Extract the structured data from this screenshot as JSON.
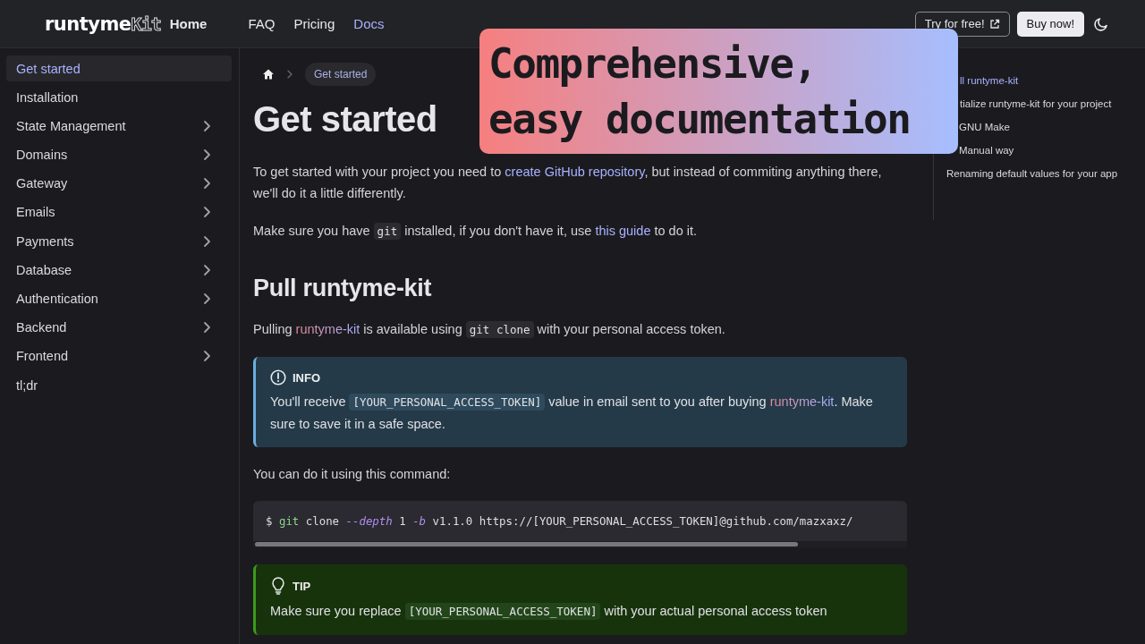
{
  "header": {
    "logo": {
      "word": "runtyme",
      "mark": "Kit"
    },
    "nav": [
      {
        "label": "Home",
        "selected": false
      },
      {
        "label": "FAQ",
        "selected": false
      },
      {
        "label": "Pricing",
        "selected": false
      },
      {
        "label": "Docs",
        "selected": true
      }
    ],
    "try_button": "Try for free!",
    "buy_button": "Buy now!"
  },
  "banner": {
    "lines": [
      "Comprehensive,",
      "easy documentation"
    ]
  },
  "sidebar": {
    "items": [
      {
        "label": "Get started",
        "selected": true,
        "expandable": false
      },
      {
        "label": "Installation",
        "selected": false,
        "expandable": false
      },
      {
        "label": "State Management",
        "selected": false,
        "expandable": true
      },
      {
        "label": "Domains",
        "selected": false,
        "expandable": true
      },
      {
        "label": "Gateway",
        "selected": false,
        "expandable": true
      },
      {
        "label": "Emails",
        "selected": false,
        "expandable": true
      },
      {
        "label": "Payments",
        "selected": false,
        "expandable": true
      },
      {
        "label": "Database",
        "selected": false,
        "expandable": true
      },
      {
        "label": "Authentication",
        "selected": false,
        "expandable": true
      },
      {
        "label": "Backend",
        "selected": false,
        "expandable": true
      },
      {
        "label": "Frontend",
        "selected": false,
        "expandable": true
      },
      {
        "label": "tl;dr",
        "selected": false,
        "expandable": false
      }
    ]
  },
  "breadcrumb": {
    "current": "Get started"
  },
  "content": [
    {
      "kind": "title",
      "text": "Get started"
    },
    {
      "kind": "paragraph",
      "segments": [
        {
          "kind": "text",
          "text": "To get started with your project you need to "
        },
        {
          "kind": "link",
          "text": "create GitHub repository"
        },
        {
          "kind": "text",
          "text": ", but instead of commiting anything there, we'll do it a little differently."
        }
      ]
    },
    {
      "kind": "paragraph",
      "segments": [
        {
          "kind": "text",
          "text": "Make sure you have "
        },
        {
          "kind": "code",
          "text": "git"
        },
        {
          "kind": "text",
          "text": " installed, if you don't have it, use "
        },
        {
          "kind": "link",
          "text": "this guide"
        },
        {
          "kind": "text",
          "text": " to do it."
        }
      ]
    },
    {
      "kind": "heading",
      "text": "Pull runtyme-kit"
    },
    {
      "kind": "paragraph",
      "segments": [
        {
          "kind": "text",
          "text": "Pulling "
        },
        {
          "kind": "brand",
          "text": "runtyme-kit"
        },
        {
          "kind": "text",
          "text": " is available using "
        },
        {
          "kind": "code",
          "text": "git clone"
        },
        {
          "kind": "text",
          "text": " with your personal access token."
        }
      ]
    },
    {
      "kind": "info",
      "label": "INFO",
      "segments": [
        {
          "kind": "text",
          "text": "You'll receive "
        },
        {
          "kind": "code",
          "text": "[YOUR_PERSONAL_ACCESS_TOKEN]"
        },
        {
          "kind": "text",
          "text": " value in email sent to you after buying "
        },
        {
          "kind": "brand",
          "text": "runtyme-kit"
        },
        {
          "kind": "text",
          "text": ". Make sure to save it in a safe space."
        }
      ]
    },
    {
      "kind": "paragraph",
      "segments": [
        {
          "kind": "text",
          "text": "You can do it using this command:"
        }
      ]
    },
    {
      "kind": "codeblock",
      "tokens": [
        {
          "kind": "prompt",
          "text": "$ "
        },
        {
          "kind": "command",
          "text": "git"
        },
        {
          "kind": "plain",
          "text": " clone "
        },
        {
          "kind": "flag",
          "text": "--depth"
        },
        {
          "kind": "plain",
          "text": " 1 "
        },
        {
          "kind": "flag",
          "text": "-b"
        },
        {
          "kind": "plain",
          "text": " v1.1.0 https://[YOUR_PERSONAL_ACCESS_TOKEN]@github.com/mazxaxz/"
        }
      ]
    },
    {
      "kind": "tip",
      "label": "TIP",
      "segments": [
        {
          "kind": "text",
          "text": "Make sure you replace "
        },
        {
          "kind": "code",
          "text": "[YOUR_PERSONAL_ACCESS_TOKEN]"
        },
        {
          "kind": "text",
          "text": " with your actual personal access token"
        }
      ]
    }
  ],
  "toc": {
    "items": [
      {
        "label": "ll runtyme-kit",
        "selected": true
      },
      {
        "label": "tialize runtyme-kit for your project",
        "selected": false,
        "children": [
          {
            "label": "GNU Make",
            "selected": false
          },
          {
            "label": "Manual way",
            "selected": false
          }
        ]
      },
      {
        "label": "Renaming default values for your app",
        "selected": false
      }
    ]
  }
}
